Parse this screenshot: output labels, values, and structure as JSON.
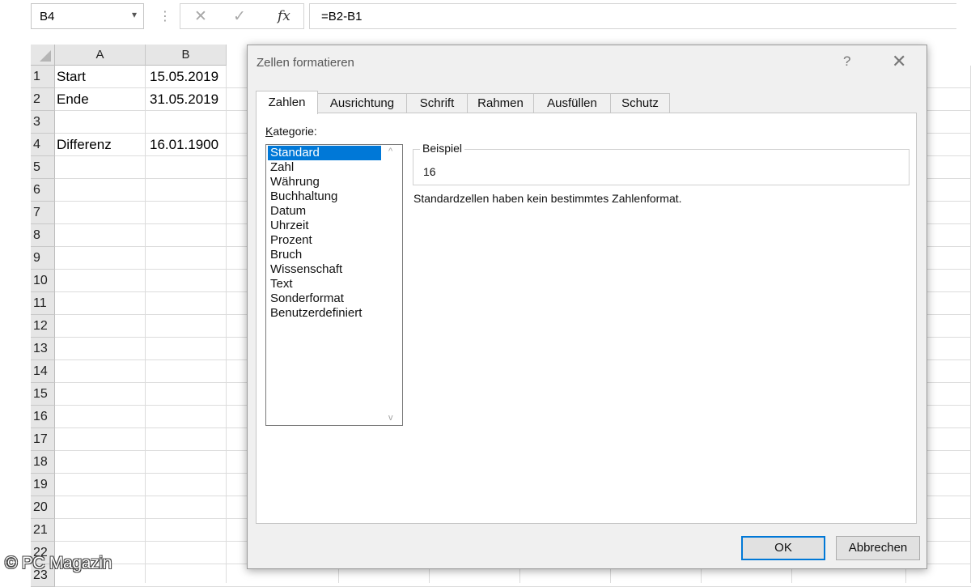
{
  "formula_bar": {
    "name_box": "B4",
    "name_box_arrow": "▾",
    "separator": "⋮",
    "cancel_glyph": "✕",
    "enter_glyph": "✓",
    "fx_glyph": "fx",
    "formula": "=B2-B1"
  },
  "grid": {
    "columns": [
      "A",
      "B"
    ],
    "rows": [
      "1",
      "2",
      "3",
      "4",
      "5",
      "6",
      "7",
      "8",
      "9",
      "10",
      "11",
      "12",
      "13",
      "14",
      "15",
      "16",
      "17",
      "18",
      "19",
      "20",
      "21",
      "22",
      "23"
    ],
    "cells": {
      "a1": "Start",
      "b1": "15.05.2019",
      "a2": "Ende",
      "b2": "31.05.2019",
      "a4": "Differenz",
      "b4": "16.01.1900"
    }
  },
  "dialog": {
    "title": "Zellen formatieren",
    "help": "?",
    "close": "✕",
    "tabs": [
      "Zahlen",
      "Ausrichtung",
      "Schrift",
      "Rahmen",
      "Ausfüllen",
      "Schutz"
    ],
    "active_tab": "Zahlen",
    "category_label_prefix": "K",
    "category_label_rest": "ategorie:",
    "categories": [
      "Standard",
      "Zahl",
      "Währung",
      "Buchhaltung",
      "Datum",
      "Uhrzeit",
      "Prozent",
      "Bruch",
      "Wissenschaft",
      "Text",
      "Sonderformat",
      "Benutzerdefiniert"
    ],
    "selected_category": "Standard",
    "scroll_up": "^",
    "scroll_down": "v",
    "sample_label": "Beispiel",
    "sample_value": "16",
    "description": "Standardzellen haben kein bestimmtes Zahlenformat.",
    "ok_label": "OK",
    "cancel_label": "Abbrechen"
  },
  "watermark": "© PC Magazin",
  "colors": {
    "selection": "#0078d7",
    "dialog_bg": "#f0f0f0",
    "header_bg": "#e6e6e6"
  }
}
